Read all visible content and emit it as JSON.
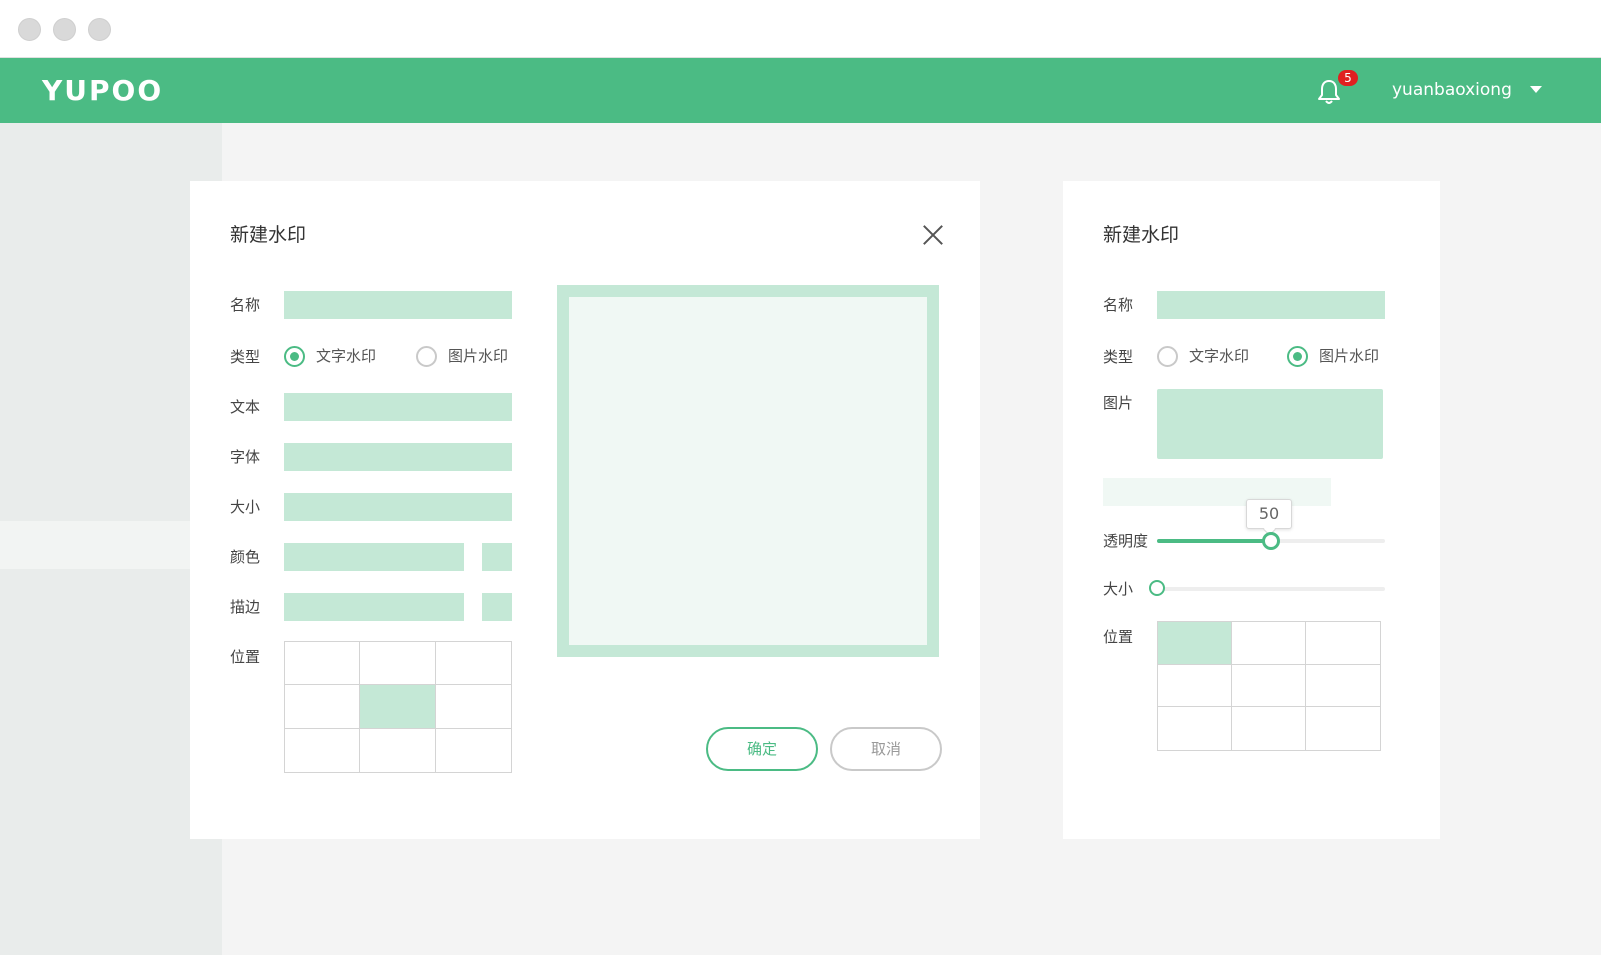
{
  "header": {
    "logo_text": "YUPOO",
    "notification_count": "5",
    "username": "yuanbaoxiong"
  },
  "colors": {
    "brand": "#4bbb84",
    "field": "#c4e8d6",
    "badge": "#e02020"
  },
  "dialog_text": {
    "title": "新建水印",
    "labels": {
      "name": "名称",
      "type": "类型",
      "text": "文本",
      "font": "字体",
      "size": "大小",
      "color": "颜色",
      "stroke": "描边",
      "position": "位置"
    },
    "type_options": [
      "文字水印",
      "图片水印"
    ],
    "selected_type": "文字水印",
    "selected_position_index": 4,
    "buttons": {
      "ok": "确定",
      "cancel": "取消"
    }
  },
  "dialog_image": {
    "title": "新建水印",
    "labels": {
      "name": "名称",
      "type": "类型",
      "image": "图片",
      "opacity": "透明度",
      "size": "大小",
      "position": "位置"
    },
    "type_options": [
      "文字水印",
      "图片水印"
    ],
    "selected_type": "图片水印",
    "opacity_value": "50",
    "opacity_fraction": 0.5,
    "size_fraction": 0.0,
    "selected_position_index": 0
  }
}
